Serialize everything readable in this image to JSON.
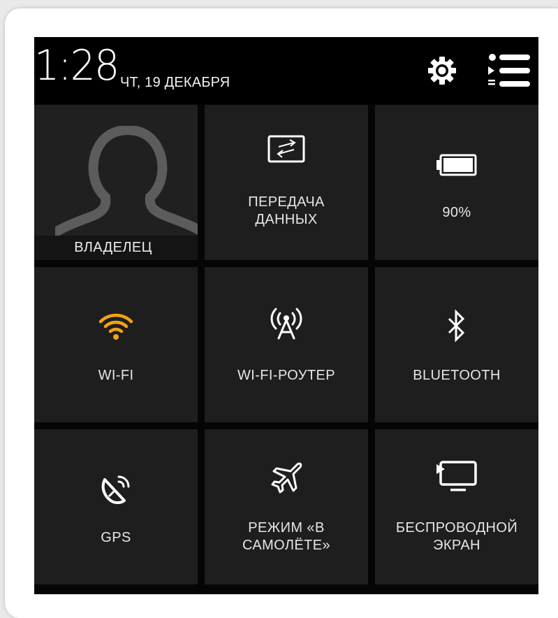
{
  "status_bar": {
    "time": "1:28",
    "date": "ЧТ, 19 ДЕКАБРЯ",
    "settings_icon": "gear-icon",
    "menu_icon": "list-menu-icon"
  },
  "tiles": {
    "owner": {
      "label": "ВЛАДЕЛЕЦ",
      "icon": "person-silhouette-icon"
    },
    "data_transfer": {
      "label": "ПЕРЕДАЧА\nДАННЫХ",
      "icon": "data-transfer-icon"
    },
    "battery": {
      "label": "90%",
      "icon": "battery-icon",
      "level": 0.9
    },
    "wifi": {
      "label": "WI-FI",
      "icon": "wifi-icon",
      "color": "#F2A413"
    },
    "hotspot": {
      "label": "WI-FI-РОУТЕР",
      "icon": "hotspot-tower-icon"
    },
    "bluetooth": {
      "label": "BLUETOOTH",
      "icon": "bluetooth-icon"
    },
    "gps": {
      "label": "GPS",
      "icon": "gps-satellite-icon"
    },
    "airplane": {
      "label": "РЕЖИМ «В\nСАМОЛЁТЕ»",
      "icon": "airplane-icon"
    },
    "wireless_display": {
      "label": "БЕСПРОВОДНОЙ\nЭКРАН",
      "icon": "wireless-display-icon"
    }
  },
  "colors": {
    "screen_bg": "#050505",
    "tile_bg": "#1E1E1E",
    "text": "#E6E6E6",
    "accent_wifi": "#F2A413"
  }
}
